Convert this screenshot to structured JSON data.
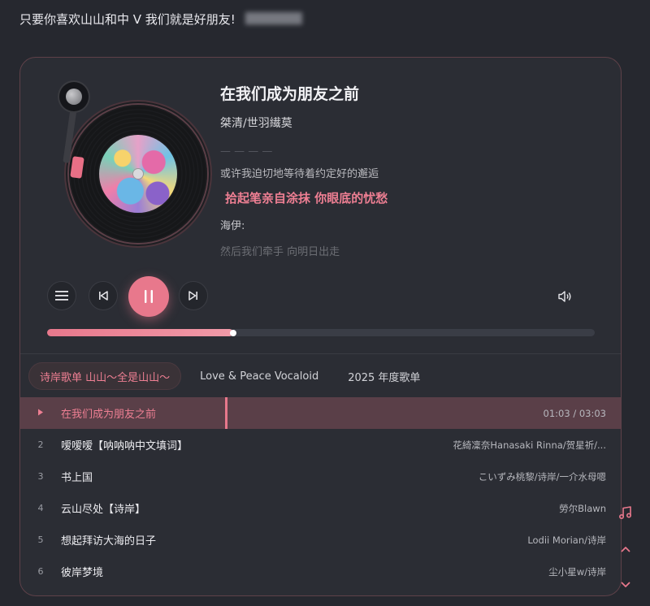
{
  "header": {
    "title": "只要你喜欢山山和中 V 我们就是好朋友!",
    "blurred_text": "███████"
  },
  "now_playing": {
    "title": "在我们成为朋友之前",
    "artist": "桀清/世羽繊莫",
    "progress": 0.34
  },
  "lyrics": {
    "faded": "— — — —",
    "line1": "或许我迫切地等待着约定好的邂逅",
    "active": "拾起笔亲自涂抹 你眼底的忧愁",
    "line3": "海伊:",
    "line4": "然后我们牵手 向明日出走"
  },
  "tabs": [
    {
      "label": "诗岸歌单 山山～全是山山～",
      "active": true
    },
    {
      "label": "Love & Peace Vocaloid",
      "active": false
    },
    {
      "label": "2025 年度歌单",
      "active": false
    }
  ],
  "tracks": [
    {
      "num": "",
      "title": "在我们成为朋友之前",
      "artist": "01:03 / 03:03",
      "current": true
    },
    {
      "num": "2",
      "title": "嗳嗳嗳【呐呐呐中文填词】",
      "artist": "花綺凜奈Hanasaki Rinna/贺星祈/...",
      "current": false
    },
    {
      "num": "3",
      "title": "书上国",
      "artist": "こいずみ桃黎/诗岸/一介水母嗯",
      "current": false
    },
    {
      "num": "4",
      "title": "云山尽处【诗岸】",
      "artist": "勞尔Blawn",
      "current": false
    },
    {
      "num": "5",
      "title": "想起拜访大海的日子",
      "artist": "Lodii Morian/诗岸",
      "current": false
    },
    {
      "num": "6",
      "title": "彼岸梦境",
      "artist": "尘小星w/诗岸",
      "current": false
    }
  ],
  "colors": {
    "accent": "#e8788c",
    "background": "#26282f",
    "card": "#2b2d34"
  }
}
